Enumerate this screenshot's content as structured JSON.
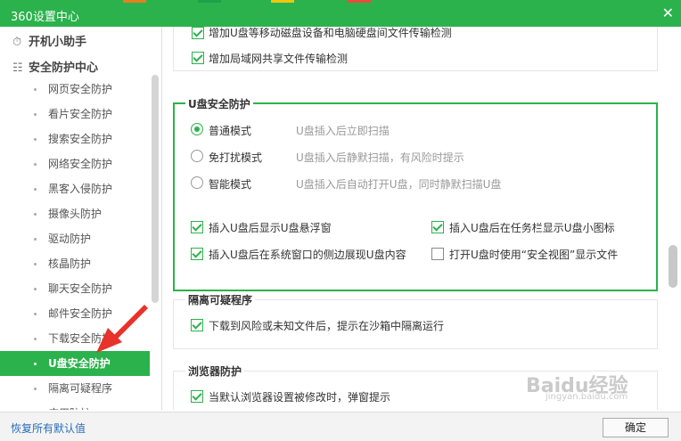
{
  "window": {
    "title": "360设置中心",
    "close": "✕"
  },
  "top_stripes": [
    "#e67e22",
    "#1aa34a",
    "#f1c40f",
    "#e74c3c"
  ],
  "sidebar": {
    "groups": [
      {
        "label": "开机小助手",
        "icon": "clock-icon"
      },
      {
        "label": "安全防护中心",
        "icon": "shield-grid-icon"
      }
    ],
    "items": [
      {
        "label": "网页安全防护"
      },
      {
        "label": "看片安全防护"
      },
      {
        "label": "搜索安全防护"
      },
      {
        "label": "网络安全防护"
      },
      {
        "label": "黑客入侵防护"
      },
      {
        "label": "摄像头防护"
      },
      {
        "label": "驱动防护"
      },
      {
        "label": "核晶防护"
      },
      {
        "label": "聊天安全防护"
      },
      {
        "label": "邮件安全防护"
      },
      {
        "label": "下载安全防护"
      },
      {
        "label": "U盘安全防护",
        "active": true
      },
      {
        "label": "隔离可疑程序"
      },
      {
        "label": "应用防护"
      }
    ]
  },
  "main": {
    "top_checks": [
      {
        "label": "增加U盘等移动磁盘设备和电脑硬盘间文件传输检测",
        "checked": true
      },
      {
        "label": "增加局域网共享文件传输检测",
        "checked": true
      }
    ],
    "usb": {
      "title": "U盘安全防护",
      "modes": [
        {
          "label": "普通模式",
          "desc": "U盘插入后立即扫描",
          "selected": true
        },
        {
          "label": "免打扰模式",
          "desc": "U盘插入后静默扫描，有风险时提示",
          "selected": false
        },
        {
          "label": "智能模式",
          "desc": "U盘插入后自动打开U盘，同时静默扫描U盘",
          "selected": false
        }
      ],
      "options": [
        {
          "label": "插入U盘后显示U盘悬浮窗",
          "checked": true
        },
        {
          "label": "插入U盘后在任务栏显示U盘小图标",
          "checked": true
        },
        {
          "label": "插入U盘后在系统窗口的侧边展现U盘内容",
          "checked": true
        },
        {
          "label": "打开U盘时使用“安全视图”显示文件",
          "checked": false
        }
      ]
    },
    "isolate": {
      "title": "隔离可疑程序",
      "check": {
        "label": "下载到风险或未知文件后，提示在沙箱中隔离运行",
        "checked": true
      }
    },
    "browser": {
      "title": "浏览器防护",
      "check": {
        "label": "当默认浏览器设置被修改时，弹窗提示",
        "checked": true
      }
    }
  },
  "footer": {
    "restore": "恢复所有默认值",
    "ok": "确定"
  },
  "watermark": {
    "brand": "Baidu经验",
    "url": "jingyan.baidu.com"
  },
  "colors": {
    "accent": "#2bb24c",
    "arrow": "#e8322a",
    "link": "#2a6ebb"
  }
}
